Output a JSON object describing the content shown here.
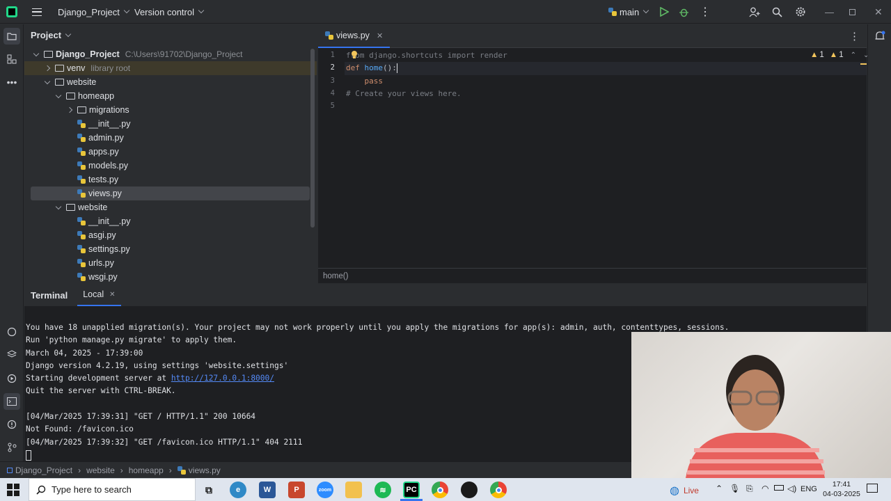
{
  "titlebar": {
    "project": "Django_Project",
    "vcs": "Version control",
    "branch": "main"
  },
  "project_panel": {
    "title": "Project",
    "root": {
      "name": "Django_Project",
      "path": "C:\\Users\\91702\\Django_Project"
    },
    "venv": {
      "name": "venv",
      "tag": "library root"
    },
    "items": [
      "website",
      "homeapp",
      "migrations",
      "__init__.py",
      "admin.py",
      "apps.py",
      "models.py",
      "tests.py",
      "views.py",
      "website",
      "__init__.py",
      "asgi.py",
      "settings.py",
      "urls.py",
      "wsgi.py"
    ]
  },
  "editor": {
    "tab": "views.py",
    "line_numbers": [
      "1",
      "2",
      "3",
      "4",
      "5"
    ],
    "code": {
      "line1": "from django.shortcuts import render",
      "line2_kw": "def",
      "line2_fn": "home",
      "line2_rest": "():",
      "line3": "    pass",
      "line4": "# Create your views here."
    },
    "warnings": "1",
    "weak_warnings": "1",
    "status": "home()"
  },
  "terminal": {
    "title": "Terminal",
    "tab": "Local",
    "lines": [
      "You have 18 unapplied migration(s). Your project may not work properly until you apply the migrations for app(s): admin, auth, contenttypes, sessions.",
      "Run 'python manage.py migrate' to apply them.",
      "March 04, 2025 - 17:39:00",
      "Django version 4.2.19, using settings 'website.settings'",
      "Starting development server at ",
      "Quit the server with CTRL-BREAK.",
      "",
      "[04/Mar/2025 17:39:31] \"GET / HTTP/1.1\" 200 10664",
      "Not Found: /favicon.ico",
      "[04/Mar/2025 17:39:32] \"GET /favicon.ico HTTP/1.1\" 404 2111"
    ],
    "link": "http://127.0.0.1:8000/"
  },
  "breadcrumb": [
    "Django_Project",
    "website",
    "homeapp",
    "views.py"
  ],
  "taskbar": {
    "search_placeholder": "Type here to search",
    "weather": "Live",
    "language": "ENG",
    "time": "17:41",
    "date": "04-03-2025"
  },
  "colors": {
    "accent": "#3574f0",
    "editor_bg": "#1e1f22",
    "panel_bg": "#2b2d30"
  }
}
